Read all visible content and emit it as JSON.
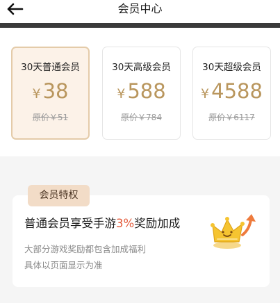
{
  "header": {
    "title": "会员中心"
  },
  "plans": [
    {
      "name": "30天普通会员",
      "currency": "¥",
      "price": "38",
      "original": "原价￥51",
      "selected": true
    },
    {
      "name": "30天高级会员",
      "currency": "¥",
      "price": "588",
      "original": "原价￥784",
      "selected": false
    },
    {
      "name": "30天超级会员",
      "currency": "¥",
      "price": "4588",
      "original": "原价￥6117",
      "selected": false
    }
  ],
  "benefit": {
    "tag": "会员特权",
    "title_prefix": "普通会员享受手游",
    "title_highlight": "3%",
    "title_suffix": "奖励加成",
    "desc_line1": "大部分游戏奖励都包含加成福利",
    "desc_line2": "具体以页面显示为准"
  },
  "icons": {
    "back": "back-arrow-icon",
    "crown": "crown-upgrade-icon"
  },
  "colors": {
    "accent_gold": "#b9965d",
    "highlight_red": "#e35a3a",
    "tag_bg": "#f2dcc7",
    "selected_bg": "#fcf2e8"
  }
}
